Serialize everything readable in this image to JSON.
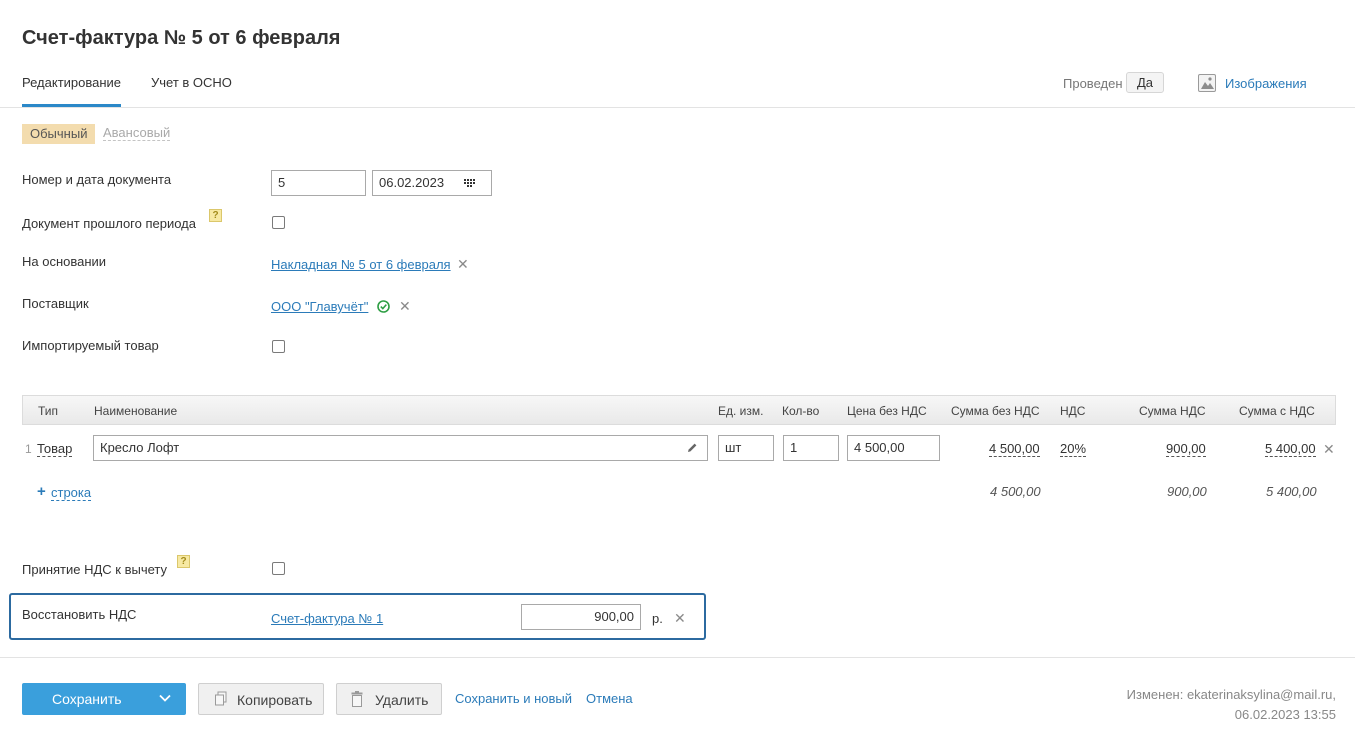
{
  "page": {
    "title": "Счет-фактура № 5 от 6 февраля"
  },
  "tabs": [
    "Редактирование",
    "Учет в ОСНО"
  ],
  "status": {
    "posted_label": "Проведен",
    "posted_value": "Да"
  },
  "images_link": "Изображения",
  "invoice_kind": {
    "active": "Обычный",
    "inactive": "Авансовый"
  },
  "form": {
    "doc_number_label": "Номер и дата документа",
    "doc_number": "5",
    "doc_date": "06.02.2023",
    "prev_period_label": "Документ прошлого периода",
    "basis_label": "На основании",
    "basis_link": "Накладная № 5 от 6 февраля",
    "supplier_label": "Поставщик",
    "supplier_link": "ООО \"Главучёт\"",
    "imported_label": "Импортируемый товар"
  },
  "table": {
    "headers": [
      "Тип",
      "Наименование",
      "Ед. изм.",
      "Кол-во",
      "Цена без НДС",
      "Сумма без НДС",
      "НДС",
      "Сумма НДС",
      "Сумма с НДС"
    ],
    "rows": [
      {
        "num": "1",
        "type": "Товар",
        "name": "Кресло Лофт",
        "unit": "шт",
        "qty": "1",
        "price": "4 500,00",
        "sum_no_vat": "4 500,00",
        "vat_rate": "20%",
        "vat_sum": "900,00",
        "sum_with_vat": "5 400,00"
      }
    ],
    "add_row_plus": "+",
    "add_row_label": "строка",
    "totals": {
      "sum_no_vat": "4 500,00",
      "vat_sum": "900,00",
      "sum_with_vat": "5 400,00"
    }
  },
  "vat": {
    "deduction_label": "Принятие НДС к вычету",
    "restore_label": "Восстановить НДС",
    "restore_link": "Счет-фактура № 1",
    "restore_amount": "900,00",
    "currency": "р."
  },
  "footer": {
    "save": "Сохранить",
    "copy": "Копировать",
    "delete": "Удалить",
    "save_new": "Сохранить и новый",
    "cancel": "Отмена",
    "changed_line1": "Изменен: ekaterinaksylina@mail.ru,",
    "changed_line2": "06.02.2023 13:55"
  },
  "colors": {
    "accent": "#2b88c8",
    "link": "#2b7bb9",
    "save_button": "#3a9fdc",
    "kind_highlight": "#f3dcae",
    "focus_border": "#2c6aa0",
    "success": "#2e9e44"
  }
}
